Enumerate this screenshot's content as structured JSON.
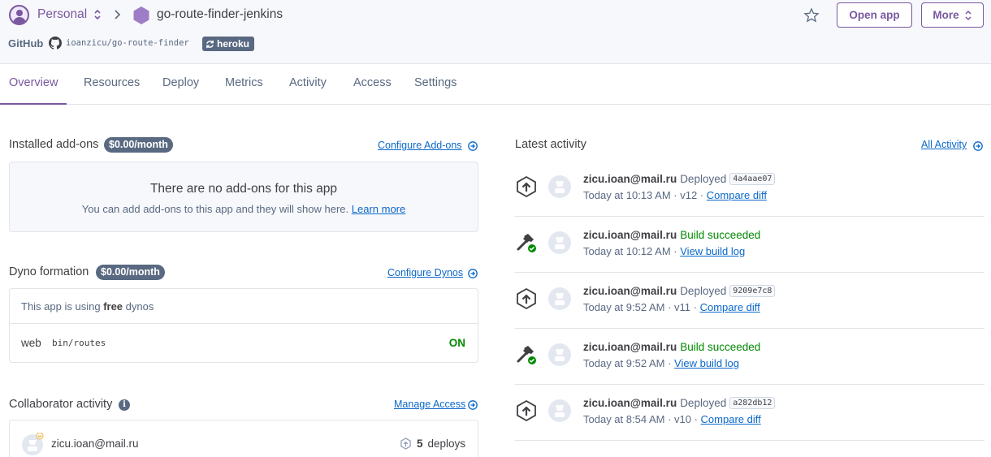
{
  "header": {
    "account": "Personal",
    "app_name": "go-route-finder-jenkins",
    "github_label": "GitHub",
    "repo": "ioanzicu/go-route-finder",
    "pipeline_badge": "heroku",
    "open_app": "Open app",
    "more": "More"
  },
  "tabs": [
    "Overview",
    "Resources",
    "Deploy",
    "Metrics",
    "Activity",
    "Access",
    "Settings"
  ],
  "addons": {
    "title": "Installed add-ons",
    "price": "$0.00/month",
    "configure": "Configure Add-ons",
    "empty_title": "There are no add-ons for this app",
    "empty_sub": "You can add add-ons to this app and they will show here.",
    "learn_more": "Learn more"
  },
  "dynos": {
    "title": "Dyno formation",
    "price": "$0.00/month",
    "configure": "Configure Dynos",
    "info_prefix": "This app is using",
    "info_bold": "free",
    "info_suffix": "dynos",
    "type": "web",
    "command": "bin/routes",
    "state": "ON"
  },
  "collaborators": {
    "title": "Collaborator activity",
    "manage": "Manage Access",
    "email": "zicu.ioan@mail.ru",
    "deploys_count": "5",
    "deploys_label": "deploys"
  },
  "activity": {
    "title": "Latest activity",
    "all": "All Activity",
    "items": [
      {
        "kind": "deploy",
        "who": "zicu.ioan@mail.ru",
        "action": "Deployed",
        "sha": "4a4aae07",
        "when": "Today at 10:13 AM · v12 ·",
        "link": "Compare diff"
      },
      {
        "kind": "build",
        "who": "zicu.ioan@mail.ru",
        "action": "Build succeeded",
        "sha": "",
        "when": "Today at 10:12 AM ·",
        "link": "View build log"
      },
      {
        "kind": "deploy",
        "who": "zicu.ioan@mail.ru",
        "action": "Deployed",
        "sha": "9209e7c8",
        "when": "Today at 9:52 AM · v11 ·",
        "link": "Compare diff"
      },
      {
        "kind": "build",
        "who": "zicu.ioan@mail.ru",
        "action": "Build succeeded",
        "sha": "",
        "when": "Today at 9:52 AM ·",
        "link": "View build log"
      },
      {
        "kind": "deploy",
        "who": "zicu.ioan@mail.ru",
        "action": "Deployed",
        "sha": "a282db12",
        "when": "Today at 8:54 AM · v10 ·",
        "link": "Compare diff"
      }
    ]
  },
  "colors": {
    "accent": "#79589f",
    "link": "#0b68c9",
    "success": "#008a00",
    "badge": "#596981"
  }
}
